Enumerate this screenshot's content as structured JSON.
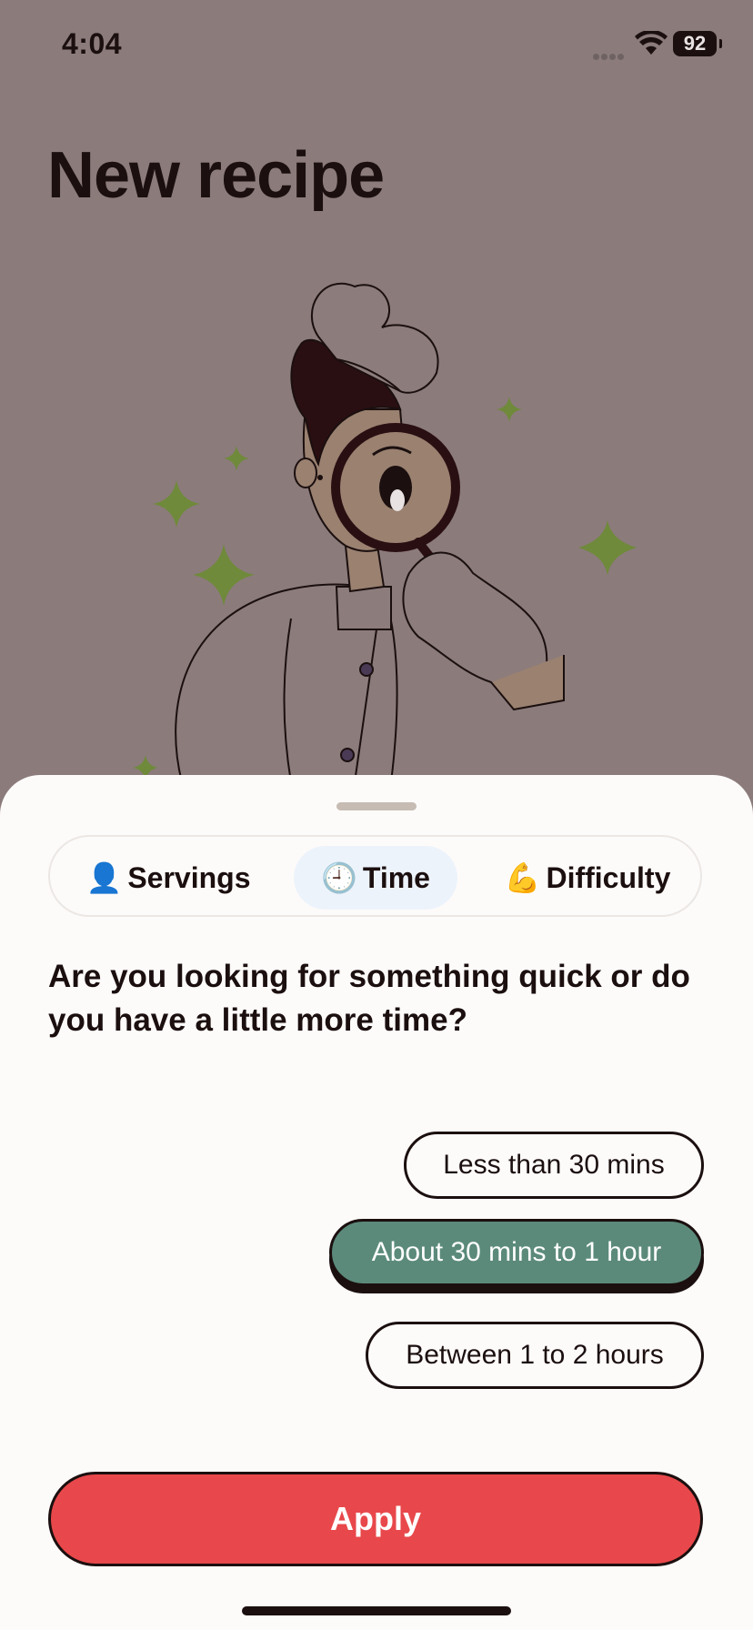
{
  "status_bar": {
    "time": "4:04",
    "battery": "92"
  },
  "page": {
    "title": "New recipe"
  },
  "filter_tabs": [
    {
      "icon": "👤",
      "label": "Servings",
      "selected": false
    },
    {
      "icon": "🕘",
      "label": "Time",
      "selected": true
    },
    {
      "icon": "💪",
      "label": "Difficulty",
      "selected": false
    }
  ],
  "question": "Are you looking for something quick or do you have a little more time?",
  "options": [
    {
      "label": "Less than 30 mins",
      "selected": false
    },
    {
      "label": "About 30 mins to 1 hour",
      "selected": true
    },
    {
      "label": "Between 1 to 2 hours",
      "selected": false
    }
  ],
  "apply_label": "Apply",
  "colors": {
    "backdrop": "#8b7b7b",
    "sheet": "#fdfbfa",
    "selected_option": "#5b8a7b",
    "apply": "#e8484b",
    "active_tab": "#edf3fb",
    "sparkle": "#6f8a3a"
  }
}
